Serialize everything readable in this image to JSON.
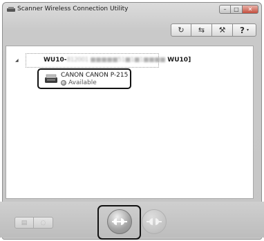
{
  "window": {
    "title": "Scanner Wireless Connection Utility",
    "controls": {
      "minimize": "–",
      "maximize": "□",
      "close": "✕"
    }
  },
  "toolbar": {
    "buttons": [
      {
        "icon": "refresh-icon",
        "glyph": "↻"
      },
      {
        "icon": "switch-icon",
        "glyph": "⇆"
      },
      {
        "icon": "tools-icon",
        "glyph": "⚒"
      },
      {
        "icon": "help-icon",
        "glyph": "?",
        "dropdown": "▾"
      }
    ]
  },
  "tree": {
    "expander": "◢",
    "node_prefix": "WU10-",
    "node_obscured": "812001 ■■■■■51■1■1■■■■",
    "node_suffix": " WU10]",
    "device": {
      "name": "CANON CANON P-215",
      "status": "Available"
    }
  },
  "bottom": {
    "left_buttons": [
      {
        "icon": "list-icon",
        "glyph": "▤"
      },
      {
        "icon": "comment-icon",
        "glyph": "◌"
      }
    ],
    "connect_icon": "connect-icon",
    "disconnect_icon": "disconnect-icon"
  },
  "colors": {
    "chrome": "#c9c9c9",
    "content_bg": "#ffffff",
    "highlight_border": "#111111",
    "close_button": "#c4503f"
  }
}
